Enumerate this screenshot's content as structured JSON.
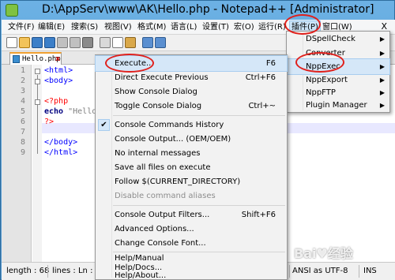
{
  "window": {
    "title": "D:\\AppServ\\www\\AK\\Hello.php - Notepad++ [Administrator]"
  },
  "menubar": {
    "items": [
      "文件(F)",
      "编辑(E)",
      "搜索(S)",
      "视图(V)",
      "格式(M)",
      "语言(L)",
      "设置(T)",
      "宏(O)",
      "运行(R)",
      "插件(P)",
      "窗口(W)"
    ],
    "close_label": "X"
  },
  "tab": {
    "label": "Hello.php",
    "close": "x"
  },
  "editor": {
    "line_numbers": [
      "1",
      "2",
      "3",
      "4",
      "5",
      "6",
      "7",
      "8",
      "9"
    ],
    "lines": {
      "l1_tag": "<html>",
      "l2_tag": "<body>",
      "l4_php": "<?php",
      "l5_kw": "echo",
      "l5_str": " \"Hello",
      "l6_php": "?>",
      "l8_tag": "</body>",
      "l9_tag": "</html>"
    }
  },
  "statusbar": {
    "length": "length : 68",
    "lines": "lines : Ln : 7",
    "encoding": "ANSI as UTF-8",
    "mode": "INS"
  },
  "plugins_menu": {
    "items": [
      {
        "label": "DSpellCheck"
      },
      {
        "label": "Converter"
      },
      {
        "label": "NppExec"
      },
      {
        "label": "NppExport"
      },
      {
        "label": "NppFTP"
      },
      {
        "label": "Plugin Manager"
      }
    ],
    "arrow": "▶"
  },
  "nppexec_menu": {
    "items": [
      {
        "label": "Execute...",
        "shortcut": "F6"
      },
      {
        "label": "Direct Execute Previous",
        "shortcut": "Ctrl+F6"
      },
      {
        "label": "Show Console Dialog",
        "shortcut": ""
      },
      {
        "label": "Toggle Console Dialog",
        "shortcut": "Ctrl+~"
      },
      {
        "label": "Console Commands History",
        "shortcut": "",
        "checked": true
      },
      {
        "label": "Console Output... (OEM/OEM)",
        "shortcut": ""
      },
      {
        "label": "No internal messages",
        "shortcut": ""
      },
      {
        "label": "Save all files on execute",
        "shortcut": ""
      },
      {
        "label": "Follow $(CURRENT_DIRECTORY)",
        "shortcut": ""
      },
      {
        "label": "Disable command aliases",
        "shortcut": "",
        "disabled": true
      },
      {
        "label": "Console Output Filters...",
        "shortcut": "Shift+F6"
      },
      {
        "label": "Advanced Options...",
        "shortcut": ""
      },
      {
        "label": "Change Console Font...",
        "shortcut": ""
      },
      {
        "label": "Help/Manual",
        "shortcut": ""
      },
      {
        "label": "Help/Docs...",
        "shortcut": ""
      },
      {
        "label": "Help/About...",
        "shortcut": ""
      }
    ],
    "check_glyph": "✔"
  },
  "watermark": "Bai♥经验",
  "colors": {
    "annotation": "#e0201c",
    "highlight": "#d5e7f8",
    "tag": "#0000ff",
    "php": "#ff0000"
  }
}
